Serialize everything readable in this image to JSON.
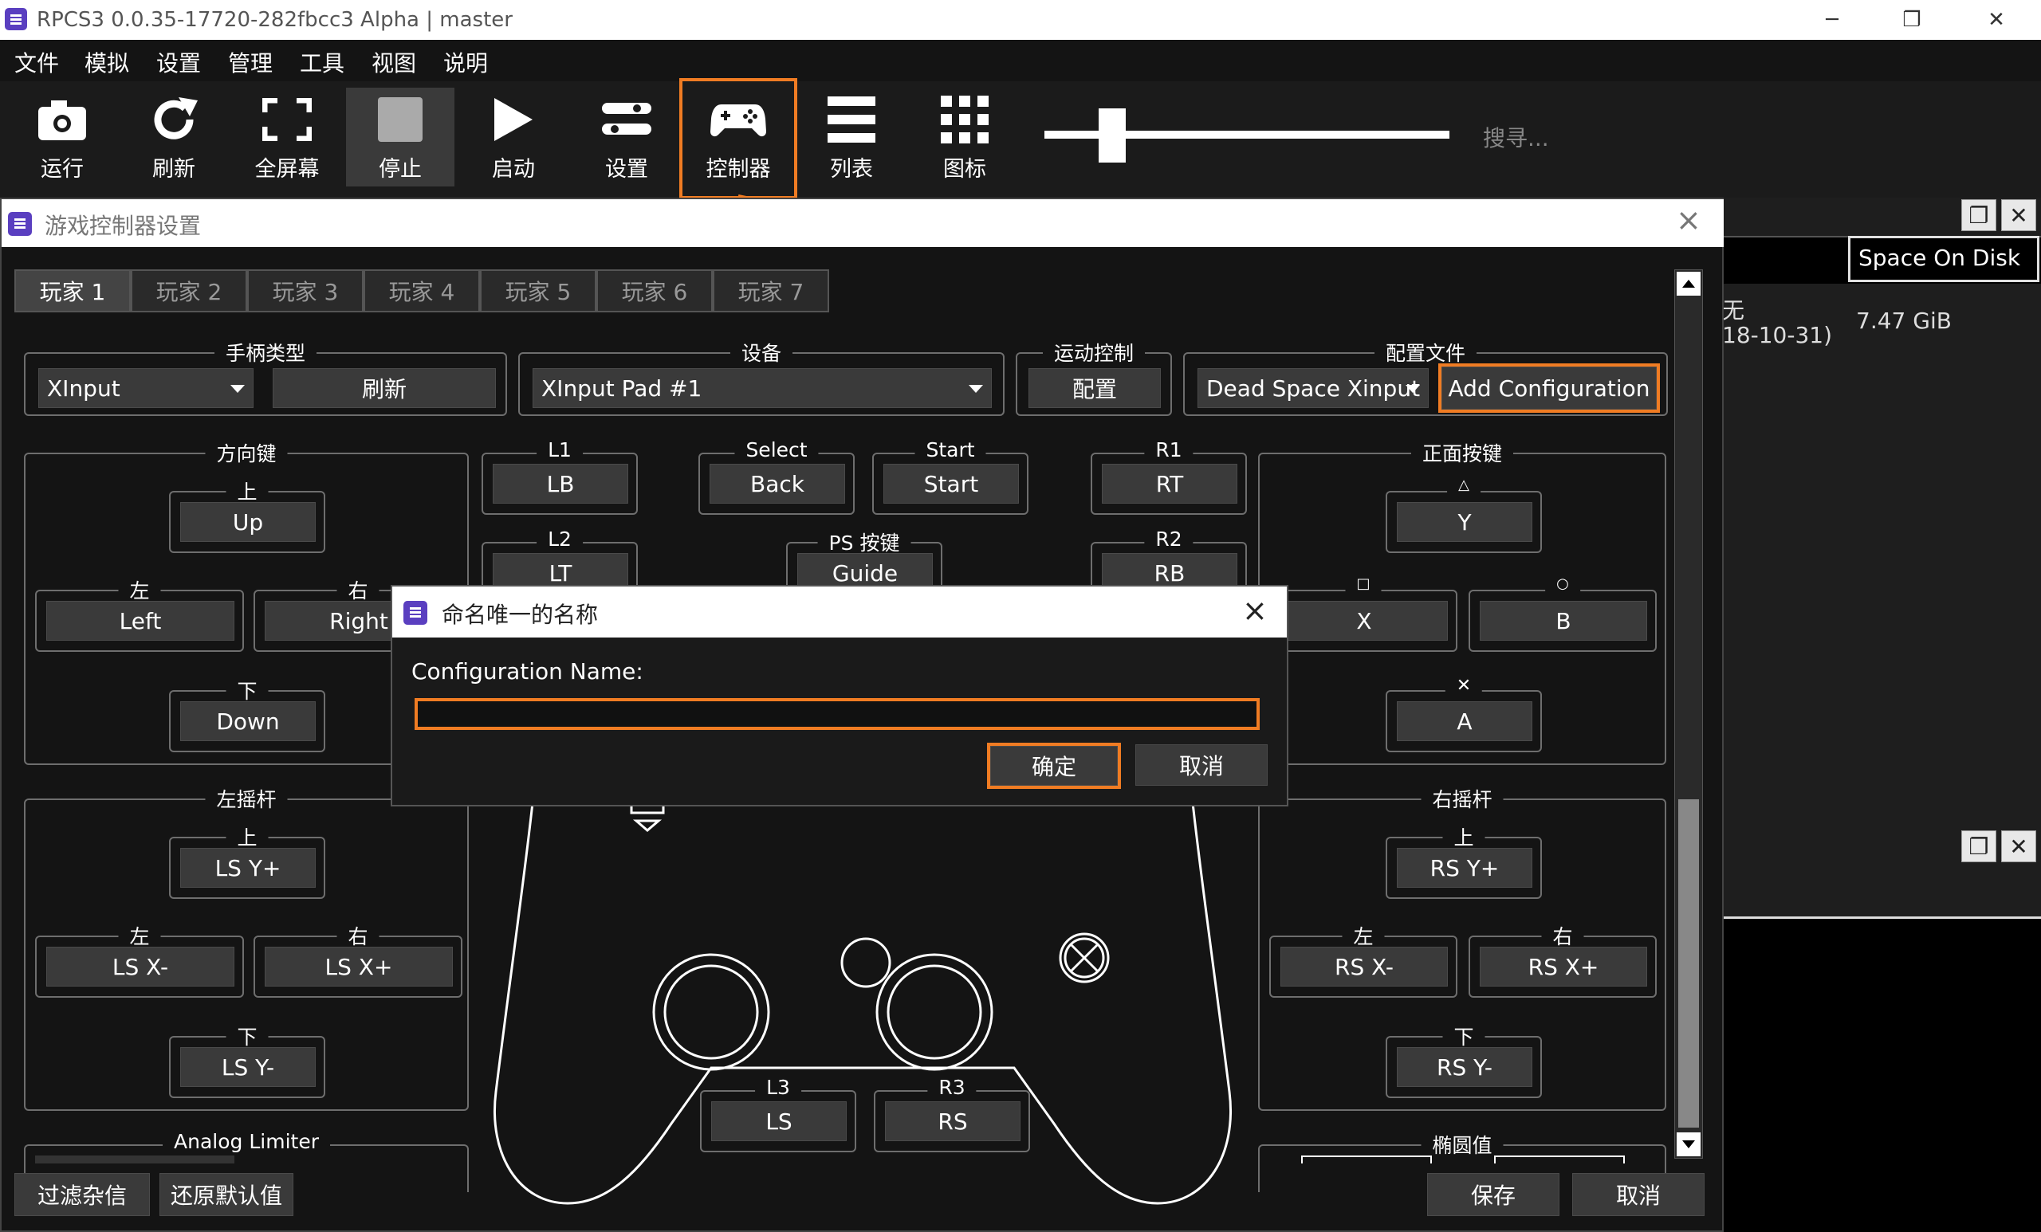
{
  "window": {
    "title": "RPCS3 0.0.35-17720-282fbcc3 Alpha | master",
    "minimize_glyph": "─",
    "restore_glyph": "❐",
    "close_glyph": "✕"
  },
  "menu": [
    "文件",
    "模拟",
    "设置",
    "管理",
    "工具",
    "视图",
    "说明"
  ],
  "toolbar": {
    "items": [
      {
        "label": "运行",
        "icon": "camera-icon"
      },
      {
        "label": "刷新",
        "icon": "refresh-icon"
      },
      {
        "label": "全屏幕",
        "icon": "fullscreen-icon"
      },
      {
        "label": "停止",
        "icon": "stop-icon"
      },
      {
        "label": "启动",
        "icon": "play-icon"
      },
      {
        "label": "设置",
        "icon": "settings-icon"
      },
      {
        "label": "控制器",
        "icon": "gamepad-icon"
      },
      {
        "label": "列表",
        "icon": "list-icon"
      },
      {
        "label": "图标",
        "icon": "grid-icon"
      }
    ],
    "search_placeholder": "搜寻..."
  },
  "game_list": {
    "column_header": "Space On Disk",
    "row_size": "7.47 GiB",
    "row_partial_a": "无",
    "row_partial_b": "18-10-31)"
  },
  "pad_settings": {
    "title": "游戏控制器设置",
    "tabs": [
      "玩家 1",
      "玩家 2",
      "玩家 3",
      "玩家 4",
      "玩家 5",
      "玩家 6",
      "玩家 7"
    ],
    "handler_type": {
      "legend": "手柄类型",
      "value": "XInput",
      "refresh": "刷新"
    },
    "device": {
      "legend": "设备",
      "value": "XInput Pad #1"
    },
    "motion": {
      "legend": "运动控制",
      "button": "配置"
    },
    "profile": {
      "legend": "配置文件",
      "value": "Dead Space Xinput",
      "add": "Add Configuration"
    },
    "dpad": {
      "legend": "方向键",
      "up_label": "上",
      "up": "Up",
      "left_label": "左",
      "left": "Left",
      "right_label": "右",
      "right": "Right",
      "down_label": "下",
      "down": "Down"
    },
    "l1": {
      "legend": "L1",
      "value": "LB"
    },
    "l2": {
      "legend": "L2",
      "value": "LT"
    },
    "select": {
      "legend": "Select",
      "value": "Back"
    },
    "start": {
      "legend": "Start",
      "value": "Start"
    },
    "ps": {
      "legend": "PS 按键",
      "value": "Guide"
    },
    "r1": {
      "legend": "R1",
      "value": "RT"
    },
    "r2": {
      "legend": "R2",
      "value": "RB"
    },
    "face": {
      "legend": "正面按键",
      "triangle_label": "△",
      "triangle": "Y",
      "square_label": "□",
      "square": "X",
      "circle_label": "○",
      "circle": "B",
      "cross_label": "✕",
      "cross": "A"
    },
    "left_stick": {
      "legend": "左摇杆",
      "up_label": "上",
      "up": "LS Y+",
      "left_label": "左",
      "left": "LS X-",
      "right_label": "右",
      "right": "LS X+",
      "down_label": "下",
      "down": "LS Y-"
    },
    "right_stick": {
      "legend": "右摇杆",
      "up_label": "上",
      "up": "RS Y+",
      "left_label": "左",
      "left": "RS X-",
      "right_label": "右",
      "right": "RS X+",
      "down_label": "下",
      "down": "RS Y-"
    },
    "l3": {
      "legend": "L3",
      "value": "LS"
    },
    "r3": {
      "legend": "R3",
      "value": "RS"
    },
    "analog_limiter": "Analog Limiter",
    "ellipse": "椭圆值",
    "filter_noise": "过滤杂信",
    "restore_defaults": "还原默认值",
    "save": "保存",
    "cancel": "取消"
  },
  "dialog": {
    "title": "命名唯一的名称",
    "label": "Configuration Name:",
    "input_value": "",
    "ok": "确定",
    "cancel": "取消"
  },
  "colors": {
    "highlight": "#f07c23",
    "app_icon": "#5a3fc0"
  }
}
